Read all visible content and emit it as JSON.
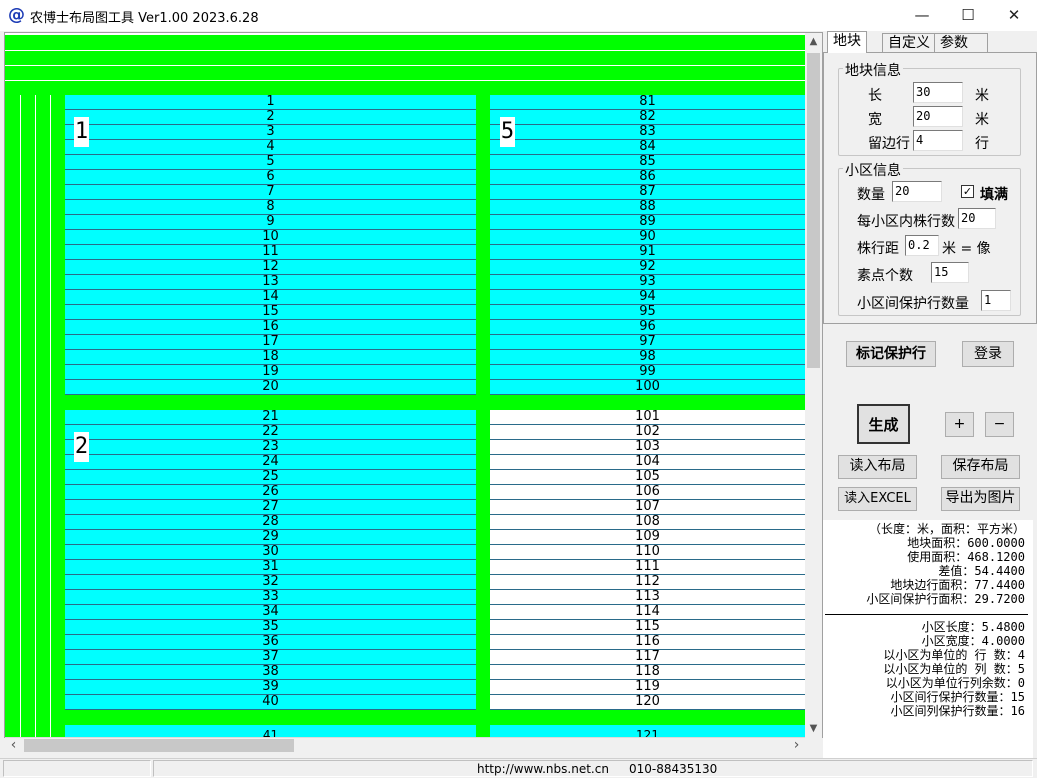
{
  "window": {
    "icon_glyph": "@",
    "title": "农博士布局图工具 Ver1.00 2023.6.28",
    "minimize": "—",
    "maximize": "☐",
    "close": "✕"
  },
  "tabs": [
    "地块",
    "自定义",
    "参数"
  ],
  "plot_info": {
    "title": "地块信息",
    "length_label": "长",
    "length_value": "30",
    "length_unit": "米",
    "width_label": "宽",
    "width_value": "20",
    "width_unit": "米",
    "margin_label": "留边行",
    "margin_value": "4",
    "margin_unit": "行"
  },
  "zone_info": {
    "title": "小区信息",
    "count_label": "数量",
    "count_value": "20",
    "fill_checked": true,
    "fill_label": "填满",
    "rows_per_zone_label": "每小区内株行数",
    "rows_per_zone_value": "20",
    "row_spacing_label": "株行距",
    "row_spacing_value": "0.2",
    "row_spacing_suffix": "米 = 像",
    "pixel_label": "素点个数",
    "pixel_value": "15",
    "protect_label": "小区间保护行数量",
    "protect_value": "1"
  },
  "buttons": {
    "mark_protect": "标记保护行",
    "login": "登录",
    "generate": "生成",
    "plus": "+",
    "minus": "−",
    "load_layout": "读入布局",
    "save_layout": "保存布局",
    "load_excel": "读入EXCEL",
    "export_image": "导出为图片"
  },
  "stats": {
    "lines_top": [
      "（长度：米，面积：平方米）",
      "地块面积：600.0000",
      "使用面积：468.1200",
      "差值：54.4400",
      "地块边行面积：77.4400",
      "小区间保护行面积：29.7200"
    ],
    "lines_bottom": [
      "小区长度：5.4800",
      "小区宽度：4.0000",
      "以小区为单位的 行 数：4",
      "以小区为单位的 列 数：5",
      "以小区为单位行列余数：0",
      "小区间行保护行数量：15",
      "小区间列保护行数量：16"
    ]
  },
  "status": {
    "url": "http://www.nbs.net.cn",
    "phone": "010-88435130"
  },
  "layout_canvas": {
    "block_labels": [
      "1",
      "5",
      "2"
    ],
    "block1_rows": [
      "1",
      "2",
      "3",
      "4",
      "5",
      "6",
      "7",
      "8",
      "9",
      "10",
      "11",
      "12",
      "13",
      "14",
      "15",
      "16",
      "17",
      "18",
      "19",
      "20"
    ],
    "block5_rows": [
      "81",
      "82",
      "83",
      "84",
      "85",
      "86",
      "87",
      "88",
      "89",
      "90",
      "91",
      "92",
      "93",
      "94",
      "95",
      "96",
      "97",
      "98",
      "99",
      "100"
    ],
    "block2_rows": [
      "21",
      "22",
      "23",
      "24",
      "25",
      "26",
      "27",
      "28",
      "29",
      "30",
      "31",
      "32",
      "33",
      "34",
      "35",
      "36",
      "37",
      "38",
      "39",
      "40"
    ],
    "block6_rows": [
      "101",
      "102",
      "103",
      "104",
      "105",
      "106",
      "107",
      "108",
      "109",
      "110",
      "111",
      "112",
      "113",
      "114",
      "115",
      "116",
      "117",
      "118",
      "119",
      "120"
    ],
    "next_rows": [
      "41",
      "121"
    ]
  },
  "colors": {
    "protect_row": "#00ff00",
    "zone_fill": "#00ffff",
    "unfilled": "#ffffff",
    "row_line": "#2a6b8a"
  },
  "icons": {
    "scroll_up": "▲",
    "scroll_down": "▼",
    "scroll_left": "‹",
    "scroll_right": "›"
  }
}
